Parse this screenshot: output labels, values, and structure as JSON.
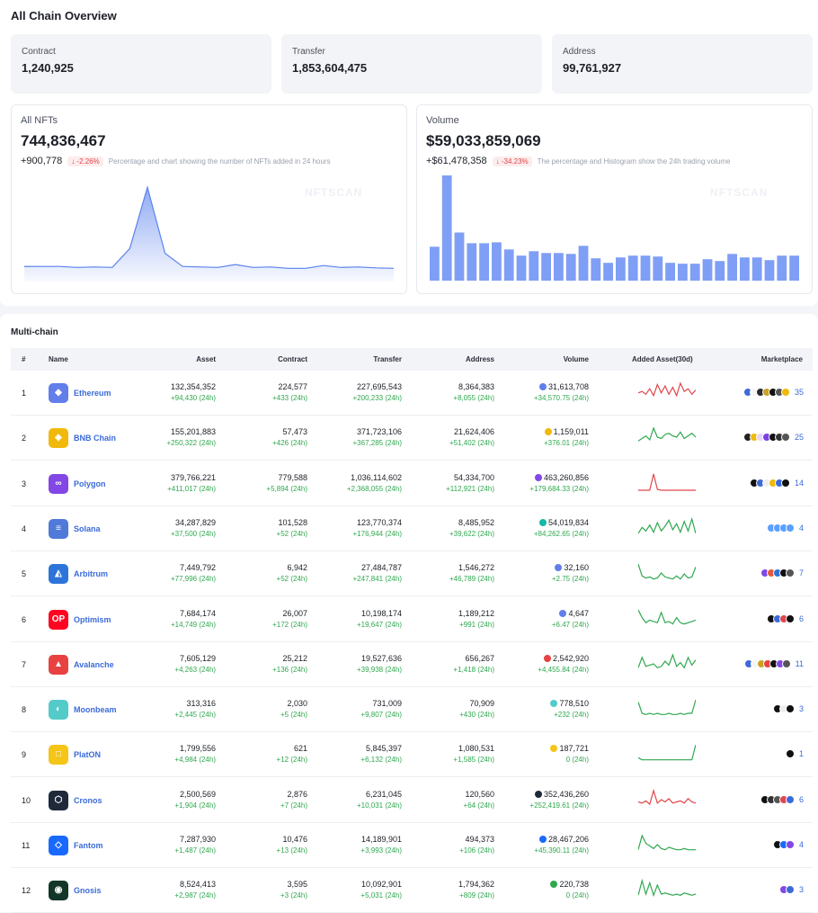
{
  "overview": {
    "title": "All Chain Overview",
    "contract": {
      "label": "Contract",
      "value": "1,240,925"
    },
    "transfer": {
      "label": "Transfer",
      "value": "1,853,604,475"
    },
    "address": {
      "label": "Address",
      "value": "99,761,927"
    },
    "nfts": {
      "label": "All NFTs",
      "value": "744,836,467",
      "change": "+900,778",
      "pct": "↓ -2.26%",
      "note": "Percentage and chart showing the number of NFTs added in 24 hours",
      "watermark": "NFTSCAN"
    },
    "volume": {
      "label": "Volume",
      "value": "$59,033,859,069",
      "change": "+$61,478,358",
      "pct": "↓ -34.23%",
      "note": "The percentage and Histogram show the 24h trading volume",
      "watermark": "NFTSCAN"
    },
    "nft_series": [
      32,
      32,
      32,
      30,
      31,
      30,
      70,
      200,
      60,
      32,
      31,
      30,
      36,
      30,
      31,
      28,
      28,
      34,
      30,
      31,
      29,
      28
    ],
    "volume_bars": [
      38,
      118,
      54,
      42,
      42,
      43,
      35,
      28,
      33,
      31,
      31,
      30,
      39,
      25,
      20,
      26,
      28,
      28,
      27,
      20,
      19,
      19,
      24,
      22,
      30,
      26,
      26,
      23,
      28,
      28
    ]
  },
  "multichain": {
    "title": "Multi-chain",
    "headers": {
      "idx": "#",
      "name": "Name",
      "asset": "Asset",
      "contract": "Contract",
      "transfer": "Transfer",
      "address": "Address",
      "volume": "Volume",
      "added": "Added Asset(30d)",
      "marketplace": "Marketplace"
    },
    "rows": [
      {
        "idx": "1",
        "name": "Ethereum",
        "logo_color": "#627eea",
        "logo": "◆",
        "asset": "132,354,352",
        "asset_d": "+94,430 (24h)",
        "contract": "224,577",
        "contract_d": "+433 (24h)",
        "transfer": "227,695,543",
        "transfer_d": "+200,233 (24h)",
        "address": "8,364,383",
        "address_d": "+8,055 (24h)",
        "volume": "31,613,708",
        "volume_d": "+34,570.75 (24h)",
        "vcolor": "#627eea",
        "spark_color": "#e0464b",
        "spark": [
          6,
          7,
          5,
          9,
          4,
          12,
          6,
          11,
          5,
          10,
          4,
          13,
          7,
          9,
          5,
          8
        ],
        "mk_count": "35",
        "mk_colors": [
          "#3b6bd9",
          "#f5f5f5",
          "#2a2a2a",
          "#c9a227",
          "#111",
          "#555",
          "#f0b90b"
        ]
      },
      {
        "idx": "2",
        "name": "BNB Chain",
        "logo_color": "#f0b90b",
        "logo": "◈",
        "asset": "155,201,883",
        "asset_d": "+250,322 (24h)",
        "contract": "57,473",
        "contract_d": "+426 (24h)",
        "transfer": "371,723,106",
        "transfer_d": "+367,285 (24h)",
        "address": "21,624,406",
        "address_d": "+51,402 (24h)",
        "volume": "1,159,011",
        "volume_d": "+376.01 (24h)",
        "vcolor": "#f0b90b",
        "spark_color": "#2fa84f",
        "spark": [
          4,
          6,
          8,
          5,
          14,
          7,
          6,
          9,
          10,
          8,
          7,
          11,
          6,
          8,
          10,
          7
        ],
        "mk_count": "25",
        "mk_colors": [
          "#222",
          "#f0b90b",
          "#e6d4ff",
          "#7b3fe4",
          "#111",
          "#333",
          "#555"
        ]
      },
      {
        "idx": "3",
        "name": "Polygon",
        "logo_color": "#8247e5",
        "logo": "∞",
        "asset": "379,766,221",
        "asset_d": "+411,017 (24h)",
        "contract": "779,588",
        "contract_d": "+5,894 (24h)",
        "transfer": "1,036,114,602",
        "transfer_d": "+2,368,055 (24h)",
        "address": "54,334,700",
        "address_d": "+112,921 (24h)",
        "volume": "463,260,856",
        "volume_d": "+179,684.33 (24h)",
        "vcolor": "#8247e5",
        "spark_color": "#e0464b",
        "spark": [
          2,
          2,
          2,
          2,
          20,
          3,
          2,
          2,
          2,
          2,
          2,
          2,
          2,
          2,
          2,
          2
        ],
        "mk_count": "14",
        "mk_colors": [
          "#111",
          "#3b6bd9",
          "#eee",
          "#f0b90b",
          "#3b6bd9",
          "#111"
        ]
      },
      {
        "idx": "4",
        "name": "Solana",
        "logo_color": "#4f7ad9",
        "logo": "≡",
        "asset": "34,287,829",
        "asset_d": "+37,500 (24h)",
        "contract": "101,528",
        "contract_d": "+52 (24h)",
        "transfer": "123,770,374",
        "transfer_d": "+176,944 (24h)",
        "address": "8,485,952",
        "address_d": "+39,622 (24h)",
        "volume": "54,019,834",
        "volume_d": "+84,262.65 (24h)",
        "vcolor": "#14b8a6",
        "spark_color": "#2fa84f",
        "spark": [
          3,
          8,
          5,
          10,
          4,
          12,
          5,
          9,
          14,
          6,
          11,
          4,
          13,
          5,
          15,
          3
        ],
        "mk_count": "4",
        "mk_colors": [
          "#5aa0ff",
          "#5aa0ff",
          "#5aa0ff",
          "#5aa0ff"
        ]
      },
      {
        "idx": "5",
        "name": "Arbitrum",
        "logo_color": "#2d74da",
        "logo": "◭",
        "asset": "7,449,792",
        "asset_d": "+77,996 (24h)",
        "contract": "6,942",
        "contract_d": "+52 (24h)",
        "transfer": "27,484,787",
        "transfer_d": "+247,841 (24h)",
        "address": "1,546,272",
        "address_d": "+46,789 (24h)",
        "volume": "32,160",
        "volume_d": "+2.75 (24h)",
        "vcolor": "#627eea",
        "spark_color": "#2fa84f",
        "spark": [
          18,
          6,
          4,
          5,
          3,
          4,
          9,
          5,
          4,
          3,
          6,
          3,
          8,
          4,
          5,
          15
        ],
        "mk_count": "7",
        "mk_colors": [
          "#8247e5",
          "#e35b3a",
          "#2d74da",
          "#111",
          "#555"
        ]
      },
      {
        "idx": "6",
        "name": "Optimism",
        "logo_color": "#ff0420",
        "logo": "OP",
        "asset": "7,684,174",
        "asset_d": "+14,749 (24h)",
        "contract": "26,007",
        "contract_d": "+172 (24h)",
        "transfer": "10,198,174",
        "transfer_d": "+19,647 (24h)",
        "address": "1,189,212",
        "address_d": "+991 (24h)",
        "volume": "4,647",
        "volume_d": "+6.47 (24h)",
        "vcolor": "#627eea",
        "spark_color": "#2fa84f",
        "spark": [
          14,
          8,
          4,
          6,
          5,
          4,
          12,
          4,
          5,
          3,
          8,
          4,
          3,
          4,
          5,
          6
        ],
        "mk_count": "6",
        "mk_colors": [
          "#111",
          "#3b6bd9",
          "#e0464b",
          "#111"
        ]
      },
      {
        "idx": "7",
        "name": "Avalanche",
        "logo_color": "#e84142",
        "logo": "▲",
        "asset": "7,605,129",
        "asset_d": "+4,263 (24h)",
        "contract": "25,212",
        "contract_d": "+136 (24h)",
        "transfer": "19,527,636",
        "transfer_d": "+39,938 (24h)",
        "address": "656,267",
        "address_d": "+1,418 (24h)",
        "volume": "2,542,920",
        "volume_d": "+4,455.84 (24h)",
        "vcolor": "#e84142",
        "spark_color": "#2fa84f",
        "spark": [
          4,
          12,
          5,
          6,
          7,
          4,
          5,
          9,
          6,
          14,
          5,
          8,
          4,
          12,
          6,
          10
        ],
        "mk_count": "11",
        "mk_colors": [
          "#3b6bd9",
          "#f5f5f5",
          "#c9a227",
          "#e84142",
          "#111",
          "#8247e5",
          "#555"
        ]
      },
      {
        "idx": "8",
        "name": "Moonbeam",
        "logo_color": "#53cbc8",
        "logo": "◐",
        "asset": "313,316",
        "asset_d": "+2,445 (24h)",
        "contract": "2,030",
        "contract_d": "+5 (24h)",
        "transfer": "731,009",
        "transfer_d": "+9,807 (24h)",
        "address": "70,909",
        "address_d": "+430 (24h)",
        "volume": "778,510",
        "volume_d": "+232 (24h)",
        "vcolor": "#53cbc8",
        "spark_color": "#2fa84f",
        "spark": [
          14,
          4,
          3,
          4,
          3,
          4,
          3,
          3,
          4,
          3,
          3,
          4,
          3,
          4,
          4,
          16
        ],
        "mk_count": "3",
        "mk_colors": [
          "#111",
          "#eee",
          "#111"
        ]
      },
      {
        "idx": "9",
        "name": "PlatON",
        "logo_color": "#f5c518",
        "logo": "□",
        "asset": "1,799,556",
        "asset_d": "+4,984 (24h)",
        "contract": "621",
        "contract_d": "+12 (24h)",
        "transfer": "5,845,397",
        "transfer_d": "+6,132 (24h)",
        "address": "1,080,531",
        "address_d": "+1,585 (24h)",
        "volume": "187,721",
        "volume_d": "0 (24h)",
        "vcolor": "#f5c518",
        "spark_color": "#2fa84f",
        "spark": [
          5,
          3,
          3,
          3,
          3,
          3,
          3,
          3,
          3,
          3,
          3,
          3,
          3,
          3,
          3,
          18
        ],
        "mk_count": "1",
        "mk_colors": [
          "#111"
        ]
      },
      {
        "idx": "10",
        "name": "Cronos",
        "logo_color": "#1e2a3a",
        "logo": "⬡",
        "asset": "2,500,569",
        "asset_d": "+1,904 (24h)",
        "contract": "2,876",
        "contract_d": "+7 (24h)",
        "transfer": "6,231,045",
        "transfer_d": "+10,031 (24h)",
        "address": "120,560",
        "address_d": "+64 (24h)",
        "volume": "352,436,260",
        "volume_d": "+252,419.61 (24h)",
        "vcolor": "#1e2a3a",
        "spark_color": "#e0464b",
        "spark": [
          6,
          5,
          7,
          4,
          16,
          5,
          8,
          6,
          9,
          5,
          6,
          7,
          5,
          9,
          6,
          5
        ],
        "mk_count": "6",
        "mk_colors": [
          "#111",
          "#333",
          "#555",
          "#e0464b",
          "#3b6bd9"
        ]
      },
      {
        "idx": "11",
        "name": "Fantom",
        "logo_color": "#1969ff",
        "logo": "◇",
        "asset": "7,287,930",
        "asset_d": "+1,487 (24h)",
        "contract": "10,476",
        "contract_d": "+13 (24h)",
        "transfer": "14,189,901",
        "transfer_d": "+3,993 (24h)",
        "address": "494,373",
        "address_d": "+106 (24h)",
        "volume": "28,467,206",
        "volume_d": "+45,390.11 (24h)",
        "vcolor": "#1969ff",
        "spark_color": "#2fa84f",
        "spark": [
          3,
          14,
          8,
          6,
          4,
          7,
          4,
          3,
          5,
          4,
          3,
          3,
          4,
          3,
          3,
          3
        ],
        "mk_count": "4",
        "mk_colors": [
          "#111",
          "#1969ff",
          "#8247e5"
        ]
      },
      {
        "idx": "12",
        "name": "Gnosis",
        "logo_color": "#133629",
        "logo": "◉",
        "asset": "8,524,413",
        "asset_d": "+2,987 (24h)",
        "contract": "3,595",
        "contract_d": "+3 (24h)",
        "transfer": "10,092,901",
        "transfer_d": "+5,031 (24h)",
        "address": "1,794,362",
        "address_d": "+809 (24h)",
        "volume": "220,738",
        "volume_d": "0 (24h)",
        "vcolor": "#2fa84f",
        "spark_color": "#2fa84f",
        "spark": [
          3,
          16,
          4,
          14,
          3,
          12,
          4,
          5,
          4,
          3,
          4,
          3,
          5,
          4,
          3,
          4
        ],
        "mk_count": "3",
        "mk_colors": [
          "#8247e5",
          "#3b6bd9"
        ]
      }
    ]
  }
}
